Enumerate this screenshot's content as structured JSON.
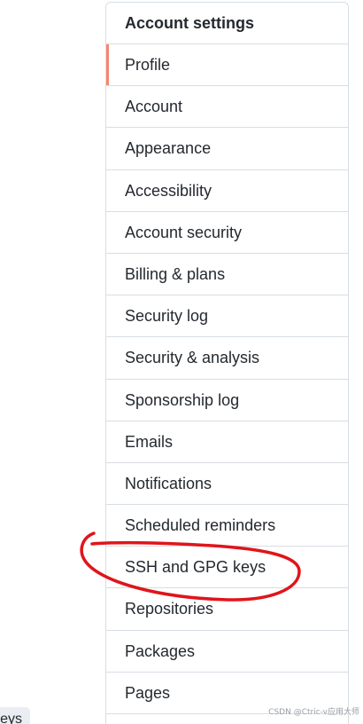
{
  "sidebar": {
    "heading": "Account settings",
    "selected_index": 0,
    "items": [
      {
        "label": "Profile"
      },
      {
        "label": "Account"
      },
      {
        "label": "Appearance"
      },
      {
        "label": "Accessibility"
      },
      {
        "label": "Account security"
      },
      {
        "label": "Billing & plans"
      },
      {
        "label": "Security log"
      },
      {
        "label": "Security & analysis"
      },
      {
        "label": "Sponsorship log"
      },
      {
        "label": "Emails"
      },
      {
        "label": "Notifications"
      },
      {
        "label": "Scheduled reminders"
      },
      {
        "label": "SSH and GPG keys"
      },
      {
        "label": "Repositories"
      },
      {
        "label": "Packages"
      },
      {
        "label": "Pages"
      }
    ]
  },
  "left_fragment": {
    "text": "eys"
  },
  "watermark": {
    "text": "CSDN @Ctric-v应用大师"
  },
  "colors": {
    "selected_indicator": "#f4866f",
    "annotation_stroke": "#e0141b",
    "border": "#d8dee4",
    "text": "#24292f"
  }
}
